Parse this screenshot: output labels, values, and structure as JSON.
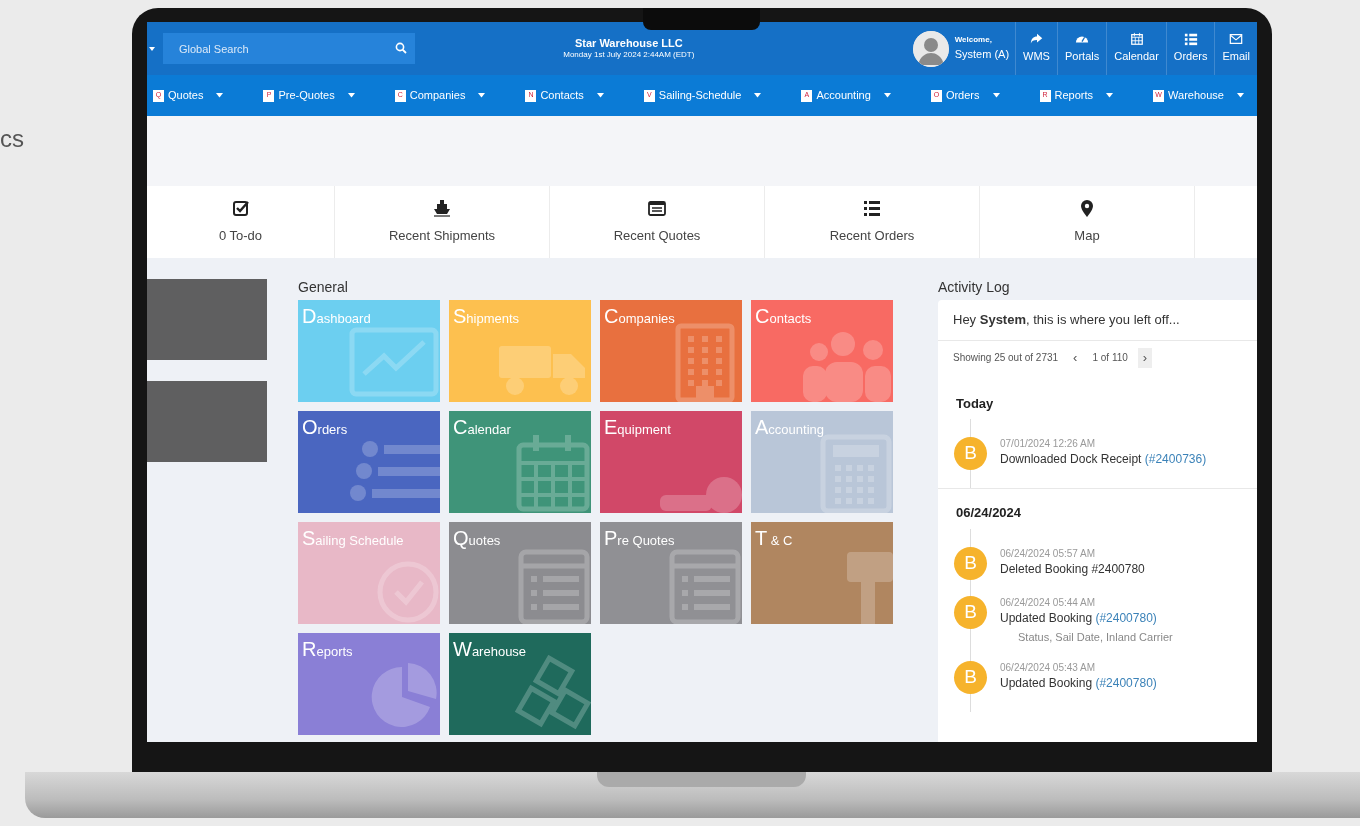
{
  "backdrop_text": "cs",
  "header": {
    "search": {
      "placeholder": "Global Search"
    },
    "company": "Star Warehouse LLC",
    "datetime": "Monday 1st July 2024 2:44AM (EDT)",
    "user": {
      "greeting": "Welcome,",
      "name": "System (A)"
    },
    "links": [
      {
        "label": "WMS"
      },
      {
        "label": "Portals"
      },
      {
        "label": "Calendar"
      },
      {
        "label": "Orders"
      },
      {
        "label": "Email"
      }
    ]
  },
  "menu": [
    {
      "badge": "Q",
      "label": "Quotes"
    },
    {
      "badge": "P",
      "label": "Pre-Quotes"
    },
    {
      "badge": "C",
      "label": "Companies"
    },
    {
      "badge": "N",
      "label": "Contacts"
    },
    {
      "badge": "V",
      "label": "Sailing-Schedule"
    },
    {
      "badge": "A",
      "label": "Accounting"
    },
    {
      "badge": "O",
      "label": "Orders"
    },
    {
      "badge": "R",
      "label": "Reports"
    },
    {
      "badge": "W",
      "label": "Warehouse"
    }
  ],
  "quick_links": [
    {
      "label": "0 To-do"
    },
    {
      "label": "Recent Shipments"
    },
    {
      "label": "Recent Quotes"
    },
    {
      "label": "Recent Orders"
    },
    {
      "label": "Map"
    }
  ],
  "general": {
    "title": "General",
    "tiles": [
      {
        "label": "Dashboard",
        "color": "#6ccff0"
      },
      {
        "label": "Shipments",
        "color": "#fdc04f"
      },
      {
        "label": "Companies",
        "color": "#e8703f"
      },
      {
        "label": "Contacts",
        "color": "#f86a63"
      },
      {
        "label": "Orders",
        "color": "#4a66c0"
      },
      {
        "label": "Calendar",
        "color": "#3f9479"
      },
      {
        "label": "Equipment",
        "color": "#d14868"
      },
      {
        "label": "Accounting",
        "color": "#b9c6d8"
      },
      {
        "label": "Sailing Schedule",
        "color": "#e8b8c7"
      },
      {
        "label": "Quotes",
        "color": "#8c8c90"
      },
      {
        "label": "Pre Quotes",
        "color": "#909094"
      },
      {
        "label": "T & C",
        "color": "#b08660"
      },
      {
        "label": "Reports",
        "color": "#8a7fd6"
      },
      {
        "label": "Warehouse",
        "color": "#1f6a5c"
      }
    ]
  },
  "activity_log": {
    "title": "Activity Log",
    "greeting": "Hey **System**, this is where you left off...",
    "pager": {
      "summary": "Showing 25 out of 2731",
      "prev": "‹",
      "page": "1 of 110",
      "next": "›"
    },
    "groups": [
      {
        "date": "Today",
        "entries": [
          {
            "avatar": "B",
            "time": "07/01/2024 12:26 AM",
            "text": "Downloaded Dock Receipt",
            "link": "(#2400736)"
          }
        ]
      },
      {
        "date": "06/24/2024",
        "entries": [
          {
            "avatar": "B",
            "time": "06/24/2024 05:57 AM",
            "text": "Deleted Booking #2400780"
          },
          {
            "avatar": "B",
            "time": "06/24/2024 05:44 AM",
            "text": "Updated Booking",
            "link": "(#2400780)",
            "detail": "Status, Sail Date, Inland Carrier"
          },
          {
            "avatar": "B",
            "time": "06/24/2024 05:43 AM",
            "text": "Updated Booking",
            "link": "(#2400780)"
          }
        ]
      }
    ]
  }
}
